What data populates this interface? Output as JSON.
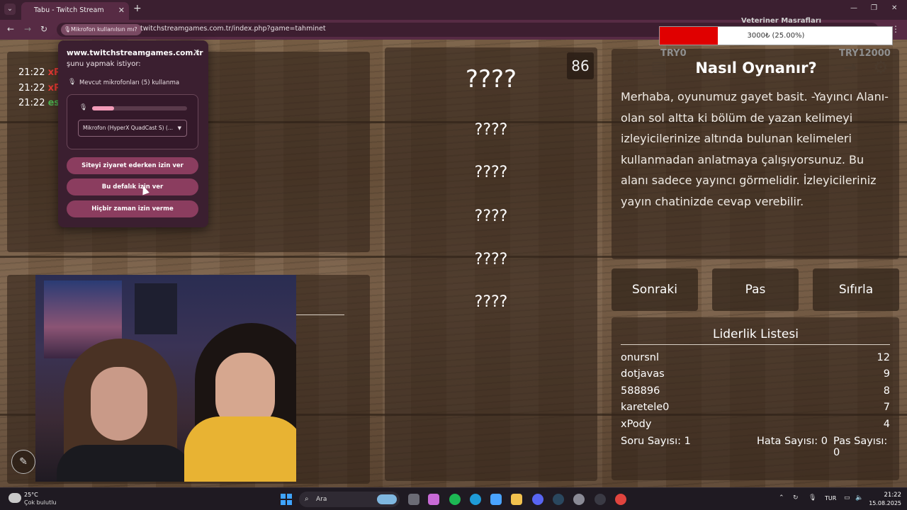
{
  "browser": {
    "tab_title": "Tabu - Twitch Stream Games",
    "mic_chip": "Mikrofon kullanılsın mı?",
    "url": "twitchstreamgames.com.tr/index.php?game=tahminet"
  },
  "donation": {
    "title": "Veteriner Masrafları",
    "progress_text": "3000₺ (25.00%)",
    "progress": 0.25,
    "min_label": "TRY0",
    "max_label": "TRY12000"
  },
  "chat": {
    "lines": [
      {
        "time": "21:22",
        "user": "xPo",
        "color": "#e53935"
      },
      {
        "time": "21:22",
        "user": "xPo",
        "color": "#e53935"
      },
      {
        "time": "21:22",
        "user": "esk",
        "color": "#4caf50"
      }
    ]
  },
  "game": {
    "timer": "86",
    "main_word": "????",
    "taboo_words": [
      "????",
      "????",
      "????",
      "????",
      "????"
    ]
  },
  "howto": {
    "title": "Nasıl Oynanır?",
    "text": "Merhaba, oyunumuz gayet basit. -Yayıncı Alanı- olan sol altta ki bölüm de yazan kelimeyi izleyicilerinize altında bulunan kelimeleri kullanmadan anlatmaya çalışıyorsunuz. Bu alanı sadece yayıncı görmelidir. İzleyicileriniz yayın chatinizde cevap verebilir."
  },
  "actions": {
    "next": "Sonraki",
    "pass": "Pas",
    "reset": "Sıfırla"
  },
  "leaderboard": {
    "title": "Liderlik Listesi",
    "rows": [
      {
        "name": "onursnl",
        "score": "12"
      },
      {
        "name": "dotjavas",
        "score": "9"
      },
      {
        "name": "588896",
        "score": "8"
      },
      {
        "name": "karetele0",
        "score": "7"
      },
      {
        "name": "xPody",
        "score": "4"
      }
    ],
    "questions": "Soru Sayısı: 1",
    "errors": "Hata Sayısı: 0",
    "passes": "Pas Sayısı: 0"
  },
  "permission": {
    "site": "www.twitchstreamgames.com.tr",
    "ask": "şunu yapmak istiyor:",
    "mic_text": "Mevcut mikrofonları (5) kullanma",
    "mic_level": 0.23,
    "device": "Mikrofon (HyperX QuadCast S) (...",
    "allow_visit": "Siteyi ziyaret ederken izin ver",
    "allow_once": "Bu defalık izin ver",
    "never": "Hiçbir zaman izin verme"
  },
  "taskbar": {
    "temp": "25°C",
    "weather": "Çok bulutlu",
    "search": "Ara",
    "lang": "TUR",
    "time": "21:22",
    "date": "15.08.2025"
  },
  "colors": {
    "accent_bar": "#e00000",
    "perm_button": "#8b3d5f"
  }
}
